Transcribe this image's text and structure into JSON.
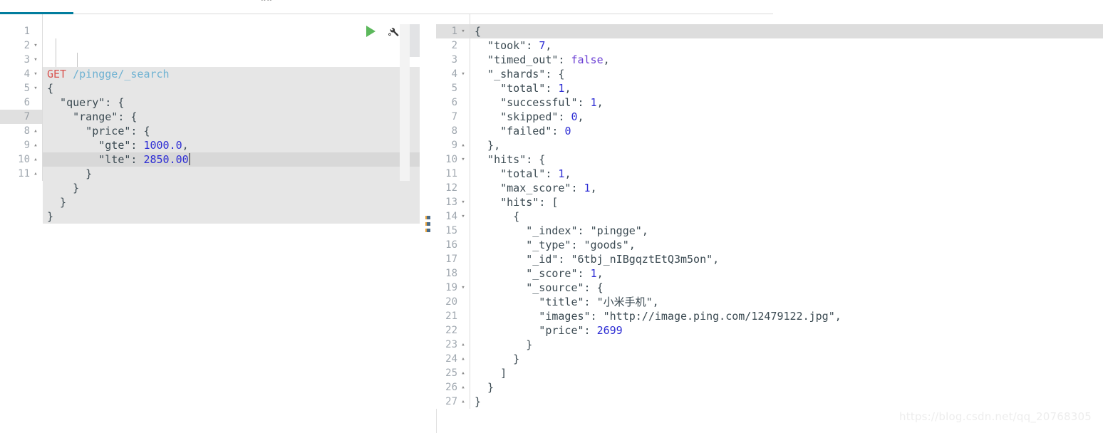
{
  "tabstrip": {
    "active_tab_label": "",
    "top_clipped_text": "oo"
  },
  "toolbar": {
    "play_label": "send-request",
    "wrench_label": "settings-wrench"
  },
  "request_editor": {
    "name": "console-request-editor",
    "active_line": 7,
    "cursor_after": "2850.00",
    "lines": [
      {
        "num": "1",
        "fold": "none",
        "tokens": [
          {
            "t": "GET",
            "c": "t-method"
          },
          {
            "t": " ",
            "c": "t-punct"
          },
          {
            "t": "/pingge/_search",
            "c": "t-url"
          }
        ]
      },
      {
        "num": "2",
        "fold": "open",
        "tokens": [
          {
            "t": "{",
            "c": "t-punct"
          }
        ]
      },
      {
        "num": "3",
        "fold": "open",
        "tokens": [
          {
            "t": "  \"query\"",
            "c": "t-key"
          },
          {
            "t": ": {",
            "c": "t-punct"
          }
        ]
      },
      {
        "num": "4",
        "fold": "open",
        "tokens": [
          {
            "t": "    \"range\"",
            "c": "t-key"
          },
          {
            "t": ": {",
            "c": "t-punct"
          }
        ]
      },
      {
        "num": "5",
        "fold": "open",
        "tokens": [
          {
            "t": "      \"price\"",
            "c": "t-key"
          },
          {
            "t": ": {",
            "c": "t-punct"
          }
        ]
      },
      {
        "num": "6",
        "fold": "none",
        "tokens": [
          {
            "t": "        \"gte\"",
            "c": "t-key"
          },
          {
            "t": ": ",
            "c": "t-punct"
          },
          {
            "t": "1000.0",
            "c": "t-num"
          },
          {
            "t": ",",
            "c": "t-punct"
          }
        ]
      },
      {
        "num": "7",
        "fold": "none",
        "active": true,
        "caret": true,
        "tokens": [
          {
            "t": "        \"lte\"",
            "c": "t-key"
          },
          {
            "t": ": ",
            "c": "t-punct"
          },
          {
            "t": "2850.00",
            "c": "t-num"
          }
        ]
      },
      {
        "num": "8",
        "fold": "close",
        "tokens": [
          {
            "t": "      }",
            "c": "t-punct"
          }
        ]
      },
      {
        "num": "9",
        "fold": "close",
        "tokens": [
          {
            "t": "    }",
            "c": "t-punct"
          }
        ]
      },
      {
        "num": "10",
        "fold": "close",
        "tokens": [
          {
            "t": "  }",
            "c": "t-punct"
          }
        ]
      },
      {
        "num": "11",
        "fold": "close",
        "tokens": [
          {
            "t": "}",
            "c": "t-punct"
          }
        ]
      }
    ],
    "raw_text": "GET /pingge/_search\n{\n  \"query\": {\n    \"range\": {\n      \"price\": {\n        \"gte\": 1000.0,\n        \"lte\": 2850.00\n      }\n    }\n  }\n}"
  },
  "response_editor": {
    "name": "console-response-output",
    "active_line": 1,
    "lines": [
      {
        "num": "1",
        "fold": "open",
        "active": true,
        "tokens": [
          {
            "t": "{",
            "c": "t-punct"
          }
        ]
      },
      {
        "num": "2",
        "fold": "none",
        "tokens": [
          {
            "t": "  \"took\"",
            "c": "t-key"
          },
          {
            "t": ": ",
            "c": "t-punct"
          },
          {
            "t": "7",
            "c": "t-num"
          },
          {
            "t": ",",
            "c": "t-punct"
          }
        ]
      },
      {
        "num": "3",
        "fold": "none",
        "tokens": [
          {
            "t": "  \"timed_out\"",
            "c": "t-key"
          },
          {
            "t": ": ",
            "c": "t-punct"
          },
          {
            "t": "false",
            "c": "t-bool"
          },
          {
            "t": ",",
            "c": "t-punct"
          }
        ]
      },
      {
        "num": "4",
        "fold": "open",
        "tokens": [
          {
            "t": "  \"_shards\"",
            "c": "t-key"
          },
          {
            "t": ": {",
            "c": "t-punct"
          }
        ]
      },
      {
        "num": "5",
        "fold": "none",
        "tokens": [
          {
            "t": "    \"total\"",
            "c": "t-key"
          },
          {
            "t": ": ",
            "c": "t-punct"
          },
          {
            "t": "1",
            "c": "t-num"
          },
          {
            "t": ",",
            "c": "t-punct"
          }
        ]
      },
      {
        "num": "6",
        "fold": "none",
        "tokens": [
          {
            "t": "    \"successful\"",
            "c": "t-key"
          },
          {
            "t": ": ",
            "c": "t-punct"
          },
          {
            "t": "1",
            "c": "t-num"
          },
          {
            "t": ",",
            "c": "t-punct"
          }
        ]
      },
      {
        "num": "7",
        "fold": "none",
        "tokens": [
          {
            "t": "    \"skipped\"",
            "c": "t-key"
          },
          {
            "t": ": ",
            "c": "t-punct"
          },
          {
            "t": "0",
            "c": "t-num"
          },
          {
            "t": ",",
            "c": "t-punct"
          }
        ]
      },
      {
        "num": "8",
        "fold": "none",
        "tokens": [
          {
            "t": "    \"failed\"",
            "c": "t-key"
          },
          {
            "t": ": ",
            "c": "t-punct"
          },
          {
            "t": "0",
            "c": "t-num"
          }
        ]
      },
      {
        "num": "9",
        "fold": "close",
        "tokens": [
          {
            "t": "  },",
            "c": "t-punct"
          }
        ]
      },
      {
        "num": "10",
        "fold": "open",
        "tokens": [
          {
            "t": "  \"hits\"",
            "c": "t-key"
          },
          {
            "t": ": {",
            "c": "t-punct"
          }
        ]
      },
      {
        "num": "11",
        "fold": "none",
        "tokens": [
          {
            "t": "    \"total\"",
            "c": "t-key"
          },
          {
            "t": ": ",
            "c": "t-punct"
          },
          {
            "t": "1",
            "c": "t-num"
          },
          {
            "t": ",",
            "c": "t-punct"
          }
        ]
      },
      {
        "num": "12",
        "fold": "none",
        "tokens": [
          {
            "t": "    \"max_score\"",
            "c": "t-key"
          },
          {
            "t": ": ",
            "c": "t-punct"
          },
          {
            "t": "1",
            "c": "t-num"
          },
          {
            "t": ",",
            "c": "t-punct"
          }
        ]
      },
      {
        "num": "13",
        "fold": "open",
        "tokens": [
          {
            "t": "    \"hits\"",
            "c": "t-key"
          },
          {
            "t": ": [",
            "c": "t-punct"
          }
        ]
      },
      {
        "num": "14",
        "fold": "open",
        "tokens": [
          {
            "t": "      {",
            "c": "t-punct"
          }
        ]
      },
      {
        "num": "15",
        "fold": "none",
        "tokens": [
          {
            "t": "        \"_index\"",
            "c": "t-key"
          },
          {
            "t": ": ",
            "c": "t-punct"
          },
          {
            "t": "\"pingge\"",
            "c": "t-str"
          },
          {
            "t": ",",
            "c": "t-punct"
          }
        ]
      },
      {
        "num": "16",
        "fold": "none",
        "tokens": [
          {
            "t": "        \"_type\"",
            "c": "t-key"
          },
          {
            "t": ": ",
            "c": "t-punct"
          },
          {
            "t": "\"goods\"",
            "c": "t-str"
          },
          {
            "t": ",",
            "c": "t-punct"
          }
        ]
      },
      {
        "num": "17",
        "fold": "none",
        "tokens": [
          {
            "t": "        \"_id\"",
            "c": "t-key"
          },
          {
            "t": ": ",
            "c": "t-punct"
          },
          {
            "t": "\"6tbj_nIBgqztEtQ3m5on\"",
            "c": "t-str"
          },
          {
            "t": ",",
            "c": "t-punct"
          }
        ]
      },
      {
        "num": "18",
        "fold": "none",
        "tokens": [
          {
            "t": "        \"_score\"",
            "c": "t-key"
          },
          {
            "t": ": ",
            "c": "t-punct"
          },
          {
            "t": "1",
            "c": "t-num"
          },
          {
            "t": ",",
            "c": "t-punct"
          }
        ]
      },
      {
        "num": "19",
        "fold": "open",
        "tokens": [
          {
            "t": "        \"_source\"",
            "c": "t-key"
          },
          {
            "t": ": {",
            "c": "t-punct"
          }
        ]
      },
      {
        "num": "20",
        "fold": "none",
        "tokens": [
          {
            "t": "          \"title\"",
            "c": "t-key"
          },
          {
            "t": ": ",
            "c": "t-punct"
          },
          {
            "t": "\"小米手机\"",
            "c": "t-str"
          },
          {
            "t": ",",
            "c": "t-punct"
          }
        ]
      },
      {
        "num": "21",
        "fold": "none",
        "tokens": [
          {
            "t": "          \"images\"",
            "c": "t-key"
          },
          {
            "t": ": ",
            "c": "t-punct"
          },
          {
            "t": "\"http://image.ping.com/12479122.jpg\"",
            "c": "t-str"
          },
          {
            "t": ",",
            "c": "t-punct"
          }
        ]
      },
      {
        "num": "22",
        "fold": "none",
        "tokens": [
          {
            "t": "          \"price\"",
            "c": "t-key"
          },
          {
            "t": ": ",
            "c": "t-punct"
          },
          {
            "t": "2699",
            "c": "t-num"
          }
        ]
      },
      {
        "num": "23",
        "fold": "close",
        "tokens": [
          {
            "t": "        }",
            "c": "t-punct"
          }
        ]
      },
      {
        "num": "24",
        "fold": "close",
        "tokens": [
          {
            "t": "      }",
            "c": "t-punct"
          }
        ]
      },
      {
        "num": "25",
        "fold": "close",
        "tokens": [
          {
            "t": "    ]",
            "c": "t-punct"
          }
        ]
      },
      {
        "num": "26",
        "fold": "close",
        "tokens": [
          {
            "t": "  }",
            "c": "t-punct"
          }
        ]
      },
      {
        "num": "27",
        "fold": "close",
        "tokens": [
          {
            "t": "}",
            "c": "t-punct"
          }
        ]
      }
    ],
    "values": {
      "took": 7,
      "timed_out": false,
      "shards_total": 1,
      "shards_successful": 1,
      "shards_skipped": 0,
      "shards_failed": 0,
      "hits_total": 1,
      "max_score": 1,
      "hit_index": "pingge",
      "hit_type": "goods",
      "hit_id": "6tbj_nIBgqztEtQ3m5on",
      "hit_score": 1,
      "source_title": "小米手机",
      "source_images": "http://image.ping.com/12479122.jpg",
      "source_price": 2699
    }
  },
  "splitter": {
    "label": "drag-to-resize"
  },
  "watermark": {
    "text": "https://blog.csdn.net/qq_20768305"
  },
  "colors": {
    "accent_tab": "#017d9e",
    "method": "#d9534f",
    "url": "#6fb2d2",
    "number": "#2d2dd4",
    "boolean": "#6b3fd4",
    "key": "#3b4a52",
    "play": "#5cb85c",
    "editor_bg": "#e6e6e6",
    "active_line": "#d8d8d8"
  }
}
